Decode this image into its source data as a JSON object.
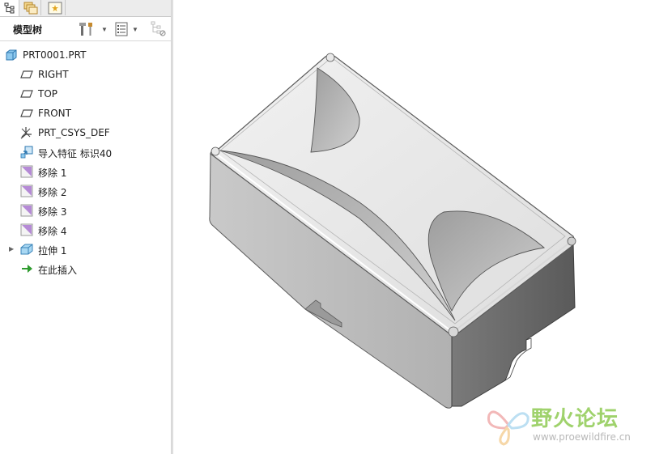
{
  "tabs": [
    {
      "name": "model-tree",
      "icon": "model-tree-tab-icon"
    },
    {
      "name": "layers",
      "icon": "layers-tab-icon"
    },
    {
      "name": "favorites",
      "icon": "favorites-tab-icon"
    }
  ],
  "toolbar": {
    "title": "模型树",
    "settings_icon": "tree-settings-icon",
    "show_icon": "tree-columns-icon",
    "filter_icon": "tree-filter-icon"
  },
  "tree": {
    "root": {
      "label": "PRT0001.PRT",
      "icon": "part-icon"
    },
    "items": [
      {
        "label": "RIGHT",
        "icon": "datum-plane-icon"
      },
      {
        "label": "TOP",
        "icon": "datum-plane-icon"
      },
      {
        "label": "FRONT",
        "icon": "datum-plane-icon"
      },
      {
        "label": "PRT_CSYS_DEF",
        "icon": "csys-icon"
      },
      {
        "label": "导入特征 标识40",
        "icon": "import-feature-icon"
      },
      {
        "label": "移除 1",
        "icon": "remove-icon"
      },
      {
        "label": "移除 2",
        "icon": "remove-icon"
      },
      {
        "label": "移除 3",
        "icon": "remove-icon"
      },
      {
        "label": "移除 4",
        "icon": "remove-icon"
      },
      {
        "label": "拉伸 1",
        "icon": "extrude-icon",
        "expandable": true
      },
      {
        "label": "在此插入",
        "icon": "insert-here-arrow-icon"
      }
    ]
  },
  "watermark": {
    "title": "野火论坛",
    "url": "www.proewildfire.cn",
    "colors": {
      "title": "#9fd26c",
      "url": "#b8b8b8"
    }
  },
  "colors": {
    "model_top": "#e6e6e6",
    "model_side_front": "#b9b9b9",
    "model_side_right": "#6c6c6c",
    "panel_bg": "#ffffff",
    "tab_bar_bg": "#ececec"
  }
}
